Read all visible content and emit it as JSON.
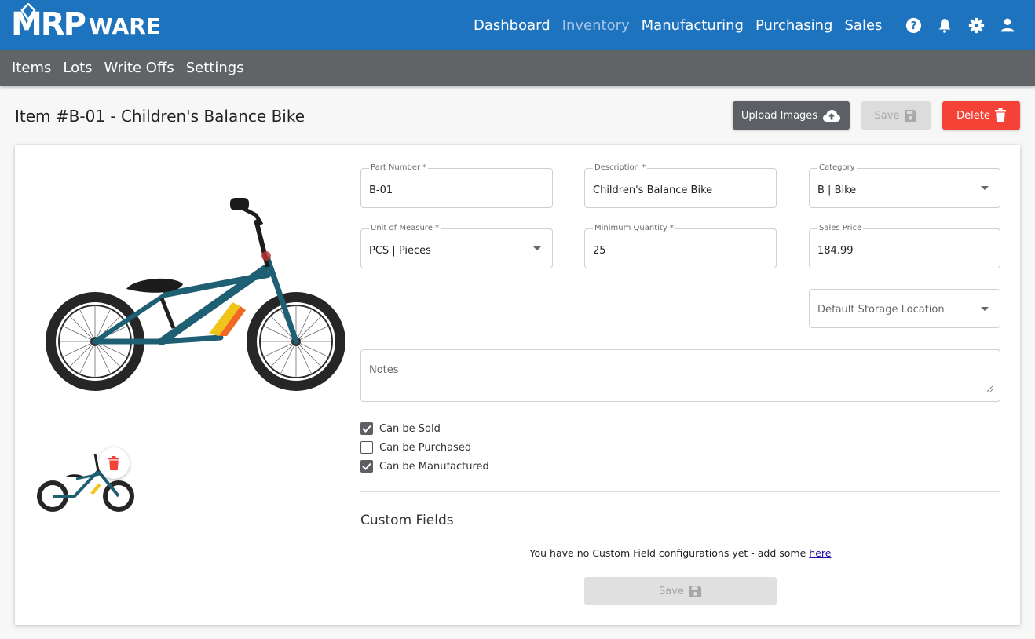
{
  "brand": {
    "logo_main": "MRP",
    "logo_sub": "WARE"
  },
  "topnav": {
    "items": [
      {
        "label": "Dashboard",
        "active": false
      },
      {
        "label": "Inventory",
        "active": true
      },
      {
        "label": "Manufacturing",
        "active": false
      },
      {
        "label": "Purchasing",
        "active": false
      },
      {
        "label": "Sales",
        "active": false
      }
    ],
    "icons": [
      "help-icon",
      "bell-icon",
      "gear-icon",
      "user-icon"
    ]
  },
  "subnav": {
    "items": [
      "Items",
      "Lots",
      "Write Offs",
      "Settings"
    ]
  },
  "page": {
    "title": "Item #B-01 - Children's Balance Bike"
  },
  "actions": {
    "upload": "Upload Images",
    "save": "Save",
    "delete": "Delete"
  },
  "form": {
    "part_number": {
      "label": "Part Number *",
      "value": "B-01"
    },
    "description": {
      "label": "Description *",
      "value": "Children's Balance Bike"
    },
    "category": {
      "label": "Category",
      "value": "B | Bike"
    },
    "unit": {
      "label": "Unit of Measure *",
      "value": "PCS | Pieces"
    },
    "min_qty": {
      "label": "Minimum Quantity *",
      "value": "25"
    },
    "sales_price": {
      "label": "Sales Price",
      "value": "184.99"
    },
    "storage": {
      "placeholder": "Default Storage Location"
    },
    "notes": {
      "placeholder": "Notes"
    },
    "checks": [
      {
        "label": "Can be Sold",
        "checked": true
      },
      {
        "label": "Can be Purchased",
        "checked": false
      },
      {
        "label": "Can be Manufactured",
        "checked": true
      }
    ]
  },
  "custom_fields": {
    "title": "Custom Fields",
    "message": "You have no Custom Field configurations yet - add some",
    "link": "here",
    "save": "Save"
  },
  "colors": {
    "primary": "#1e73be",
    "subbar": "#616467",
    "danger": "#f44336",
    "dark_button": "#5c5f63",
    "bike_frame": "#1f5f73"
  }
}
